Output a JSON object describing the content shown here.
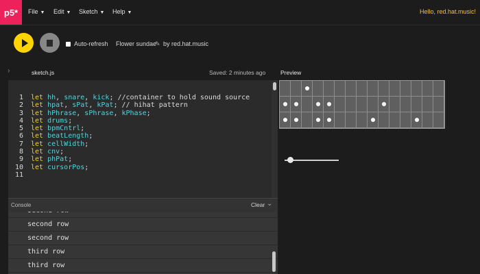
{
  "app": {
    "logo": "p5*",
    "menu": [
      "File",
      "Edit",
      "Sketch",
      "Help"
    ],
    "user_greeting": "Hello, red.hat.music!"
  },
  "toolbar": {
    "autorefresh_label": "Auto-refresh",
    "autorefresh_checked": false,
    "sketch_title": "Flower sundae",
    "sketch_owner": "by red.hat.music"
  },
  "editor": {
    "tab_filename": "sketch.js",
    "save_status": "Saved: 2 minutes ago",
    "lines": [
      {
        "n": "1",
        "tokens": [
          [
            "kw",
            "let "
          ],
          [
            "id",
            "hh"
          ],
          [
            "p",
            ", "
          ],
          [
            "id",
            "snare"
          ],
          [
            "p",
            ", "
          ],
          [
            "id",
            "kick"
          ],
          [
            "p",
            "; "
          ],
          [
            "c",
            "//container to hold sound source"
          ]
        ]
      },
      {
        "n": "2",
        "tokens": [
          [
            "kw",
            "let "
          ],
          [
            "id",
            "hpat"
          ],
          [
            "p",
            ", "
          ],
          [
            "id",
            "sPat"
          ],
          [
            "p",
            ", "
          ],
          [
            "id",
            "kPat"
          ],
          [
            "p",
            "; "
          ],
          [
            "c",
            "// hihat pattern"
          ]
        ]
      },
      {
        "n": "3",
        "tokens": [
          [
            "kw",
            "let "
          ],
          [
            "id",
            "hPhrase"
          ],
          [
            "p",
            ", "
          ],
          [
            "id",
            "sPhrase"
          ],
          [
            "p",
            ", "
          ],
          [
            "id",
            "kPhase"
          ],
          [
            "p",
            ";"
          ]
        ]
      },
      {
        "n": "4",
        "tokens": [
          [
            "kw",
            "let "
          ],
          [
            "id",
            "drums"
          ],
          [
            "p",
            ";"
          ]
        ]
      },
      {
        "n": "5",
        "tokens": [
          [
            "kw",
            "let "
          ],
          [
            "id",
            "bpmCntrl"
          ],
          [
            "p",
            ";"
          ]
        ]
      },
      {
        "n": "6",
        "tokens": [
          [
            "kw",
            "let "
          ],
          [
            "id",
            "beatLength"
          ],
          [
            "p",
            ";"
          ]
        ]
      },
      {
        "n": "7",
        "tokens": [
          [
            "kw",
            "let "
          ],
          [
            "id",
            "cellWidth"
          ],
          [
            "p",
            ";"
          ]
        ]
      },
      {
        "n": "8",
        "tokens": [
          [
            "kw",
            "let "
          ],
          [
            "id",
            "cnv"
          ],
          [
            "p",
            ";"
          ]
        ]
      },
      {
        "n": "9",
        "tokens": [
          [
            "kw",
            "let "
          ],
          [
            "id",
            "phPat"
          ],
          [
            "p",
            ";"
          ]
        ]
      },
      {
        "n": "10",
        "tokens": [
          [
            "kw",
            "let "
          ],
          [
            "id",
            "cursorPos"
          ],
          [
            "p",
            ";"
          ]
        ]
      },
      {
        "n": "11",
        "tokens": []
      }
    ]
  },
  "console": {
    "title": "Console",
    "clear_label": "Clear",
    "rows": [
      "second row",
      "second row",
      "second row",
      "third row",
      "third row"
    ]
  },
  "preview": {
    "label": "Preview",
    "columns": 15,
    "grid": [
      [
        0,
        0,
        1,
        0,
        0,
        0,
        0,
        0,
        0,
        0,
        0,
        0,
        0,
        0,
        0
      ],
      [
        1,
        1,
        0,
        1,
        1,
        0,
        0,
        0,
        0,
        1,
        0,
        0,
        0,
        0,
        0
      ],
      [
        1,
        1,
        0,
        1,
        1,
        0,
        0,
        0,
        1,
        0,
        0,
        0,
        1,
        0,
        0
      ]
    ],
    "slider_value": 0.1
  },
  "colors": {
    "accent": "#ed225d",
    "play": "#ffd400",
    "keyword": "#f4ce2d",
    "identifier": "#4fd6df"
  },
  "icons": {
    "play": "play-icon",
    "stop": "stop-icon",
    "edit": "pencil-icon",
    "collapse": "chevron-down-icon",
    "sidebar": "chevron-right-icon"
  }
}
